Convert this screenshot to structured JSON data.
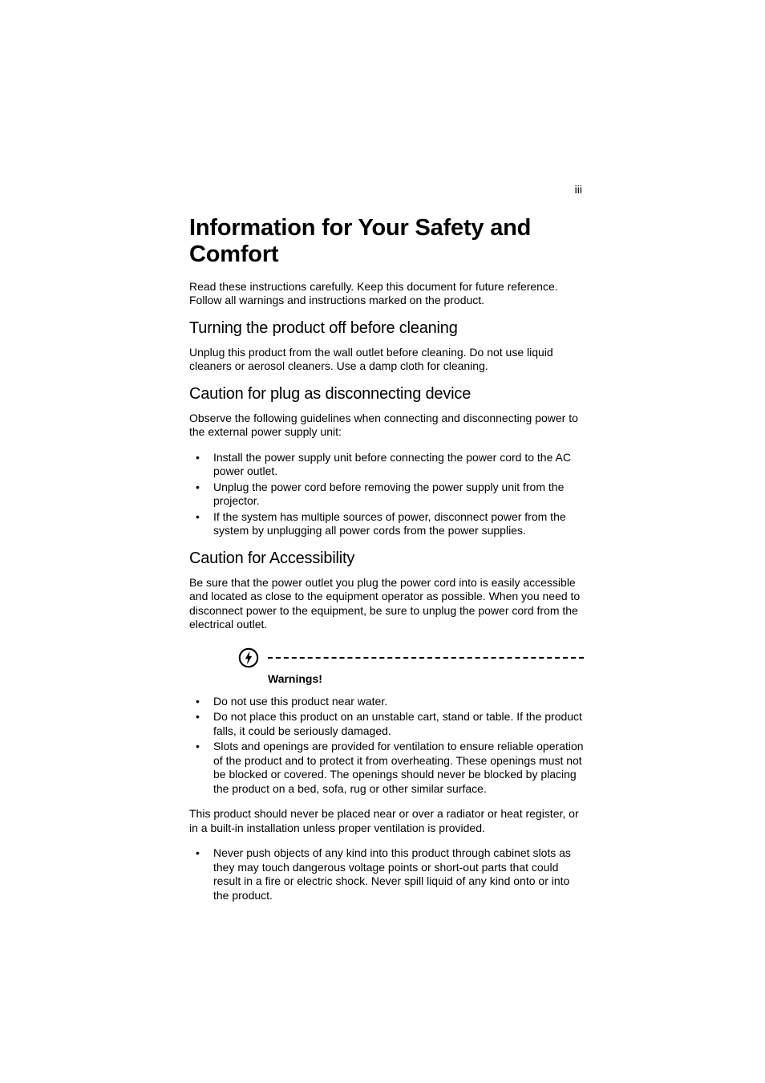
{
  "page_number": "iii",
  "title": "Information for Your Safety and Comfort",
  "intro": "Read these instructions carefully. Keep this document for future reference. Follow all warnings and instructions marked on the product.",
  "sections": {
    "s1": {
      "heading": "Turning the product off before cleaning",
      "para": "Unplug this product from the wall outlet before cleaning. Do not use liquid cleaners or aerosol cleaners. Use a damp cloth for cleaning."
    },
    "s2": {
      "heading": "Caution for plug as disconnecting device",
      "para": "Observe the following guidelines when connecting and disconnecting power to the external power supply unit:",
      "bullets": [
        "Install the power supply unit before connecting the power cord to the AC power outlet.",
        "Unplug the power cord before removing the power supply unit from the projector.",
        "If the system has multiple sources of power, disconnect power from the system by unplugging all power cords from the power supplies."
      ]
    },
    "s3": {
      "heading": "Caution for Accessibility",
      "para": "Be sure that the power outlet you plug the power cord into is easily accessible and located as close to the equipment operator as possible. When you need to disconnect power to the equipment, be sure to unplug the power cord from the electrical outlet."
    }
  },
  "warnings": {
    "label": "Warnings!",
    "bullets1": [
      "Do not use this product near water.",
      "Do not place this product on an unstable cart, stand or table. If the product falls, it could be seriously damaged.",
      "Slots and openings are provided for ventilation to ensure reliable operation of the product and to protect it from overheating. These openings must not be blocked or covered. The openings should never be blocked by placing the product on a bed, sofa, rug or other similar surface."
    ],
    "mid_para": "This product should never be placed near or over a radiator or heat register, or in a built-in installation unless proper ventilation is provided.",
    "bullets2": [
      "Never push objects of any kind into this product through cabinet slots as they may touch dangerous voltage points or short-out parts that could result in a fire or electric shock. Never spill liquid of any kind onto or into the product."
    ]
  }
}
